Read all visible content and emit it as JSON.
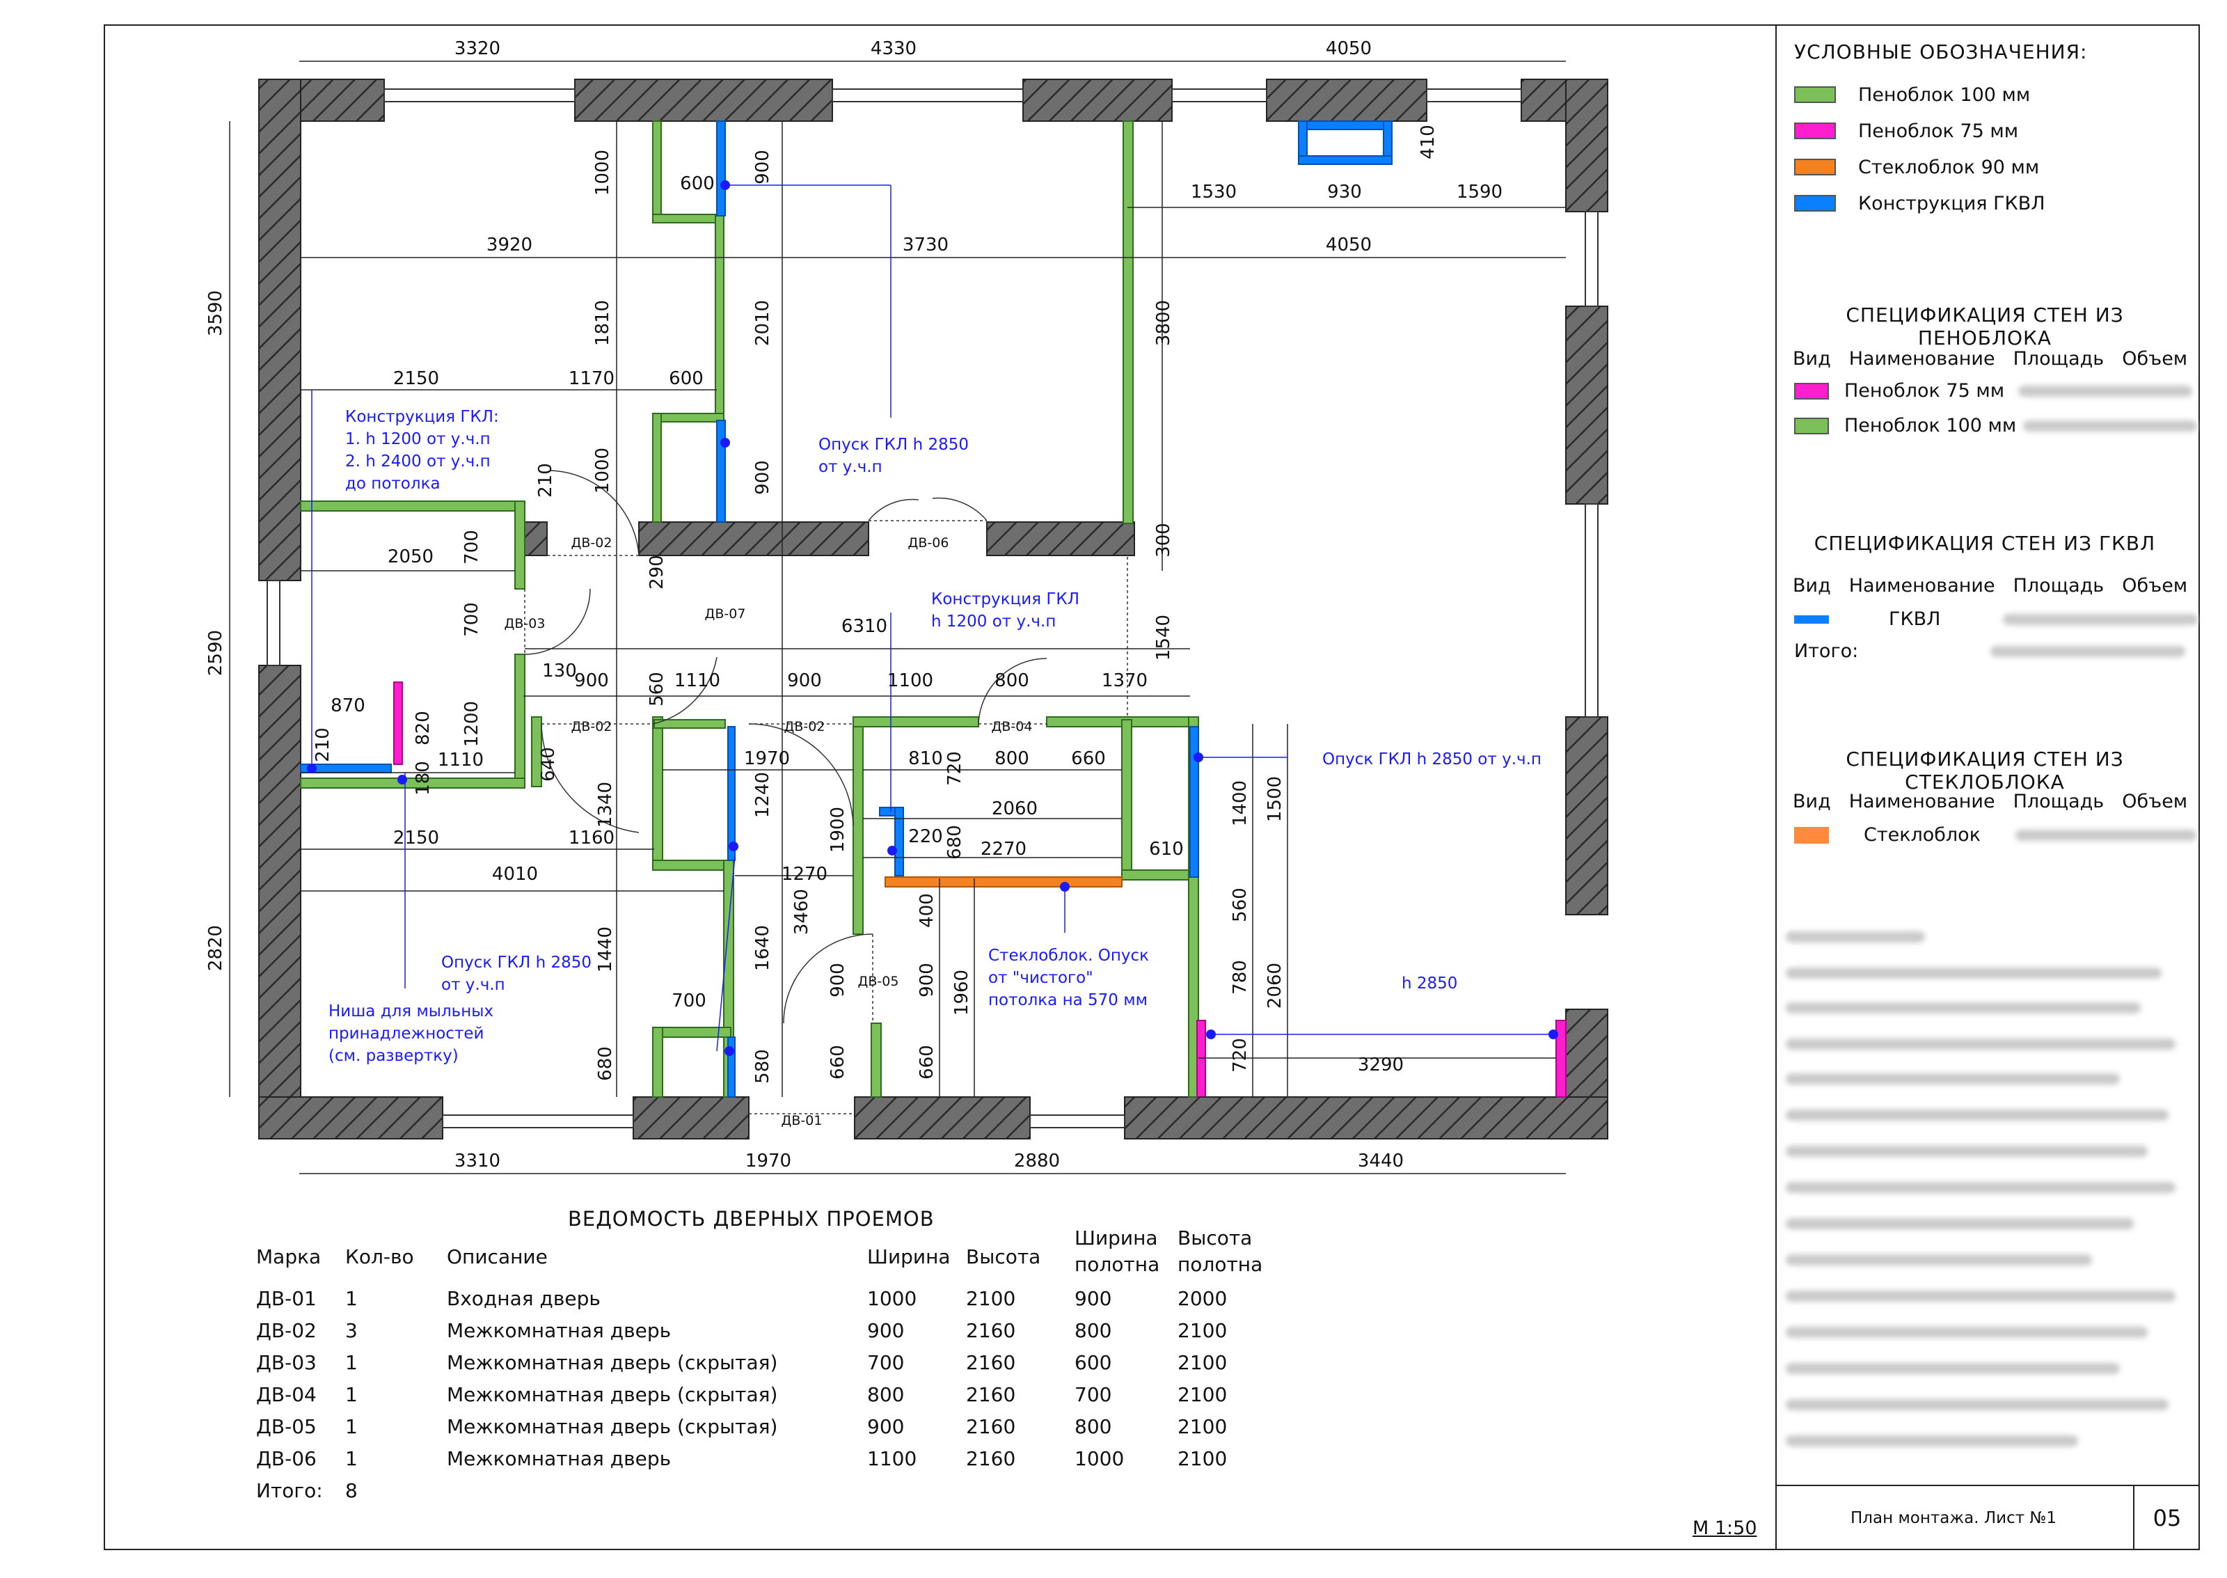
{
  "legend": {
    "title": "УСЛОВНЫЕ ОБОЗНАЧЕНИЯ:",
    "items": [
      {
        "label": "Пеноблок 100 мм",
        "color": "#7cc05a"
      },
      {
        "label": "Пеноблок 75 мм",
        "color": "#ff1ecd"
      },
      {
        "label": "Стеклоблок 90 мм",
        "color": "#f58220"
      },
      {
        "label": "Конструкция ГКВЛ",
        "color": "#0a7fff"
      }
    ]
  },
  "spec_foam": {
    "title": "СПЕЦИФИКАЦИЯ СТЕН ИЗ ПЕНОБЛОКА",
    "headers": [
      "Вид",
      "Наименование",
      "Площадь",
      "Объем"
    ],
    "rows": [
      {
        "name": "Пеноблок 75 мм",
        "color": "#ff1ecd"
      },
      {
        "name": "Пеноблок 100 мм",
        "color": "#7cc05a"
      }
    ]
  },
  "spec_gkvl": {
    "title": "СПЕЦИФИКАЦИЯ СТЕН ИЗ ГКВЛ",
    "headers": [
      "Вид",
      "Наименование",
      "Площадь",
      "Объем"
    ],
    "rows": [
      {
        "name": "ГКВЛ",
        "color": "#0a7fff"
      }
    ],
    "total_label": "Итого:"
  },
  "spec_glass": {
    "title": "СПЕЦИФИКАЦИЯ СТЕН ИЗ СТЕКЛОБЛОКА",
    "headers": [
      "Вид",
      "Наименование",
      "Площадь",
      "Объем"
    ],
    "rows": [
      {
        "name": "Стеклоблок",
        "color": "#ff8a3d"
      }
    ]
  },
  "doors": {
    "title": "ВЕДОМОСТЬ ДВЕРНЫХ ПРОЕМОВ",
    "headers": [
      "Марка",
      "Кол-во",
      "Описание",
      "Ширина",
      "Высота",
      "Ширина полотна",
      "Высота полотна"
    ],
    "rows": [
      [
        "ДВ-01",
        "1",
        "Входная дверь",
        "1000",
        "2100",
        "900",
        "2000"
      ],
      [
        "ДВ-02",
        "3",
        "Межкомнатная дверь",
        "900",
        "2160",
        "800",
        "2100"
      ],
      [
        "ДВ-03",
        "1",
        "Межкомнатная дверь (скрытая)",
        "700",
        "2160",
        "600",
        "2100"
      ],
      [
        "ДВ-04",
        "1",
        "Межкомнатная дверь (скрытая)",
        "800",
        "2160",
        "700",
        "2100"
      ],
      [
        "ДВ-05",
        "1",
        "Межкомнатная дверь (скрытая)",
        "900",
        "2160",
        "800",
        "2100"
      ],
      [
        "ДВ-06",
        "1",
        "Межкомнатная дверь",
        "1100",
        "2160",
        "1000",
        "2100"
      ]
    ],
    "total_label": "Итого:",
    "total_value": "8"
  },
  "title_block": {
    "scale": "М 1:50",
    "sheet_title": "План монтажа. Лист №1",
    "sheet_number": "05"
  },
  "plan": {
    "dims": {
      "top": [
        "3320",
        "4330",
        "4050"
      ],
      "bottom": [
        "3310",
        "1970",
        "2880",
        "3440"
      ],
      "left": [
        "3590",
        "2590",
        "2820"
      ],
      "inner": [
        "600",
        "900",
        "1000",
        "1530",
        "930",
        "1590",
        "410",
        "3920",
        "3730",
        "4050",
        "1810",
        "2010",
        "3800",
        "2150",
        "1170",
        "600",
        "1000",
        "900",
        "210",
        "2050",
        "700",
        "290",
        "300",
        "700",
        "6310",
        "1540",
        "130",
        "900",
        "1110",
        "900",
        "1100",
        "800",
        "1370",
        "560",
        "870",
        "820",
        "1200",
        "210",
        "1110",
        "180",
        "640",
        "1970",
        "810",
        "720",
        "800",
        "660",
        "1400",
        "1500",
        "1340",
        "2060",
        "1900",
        "220",
        "680",
        "2270",
        "610",
        "2150",
        "1160",
        "1240",
        "4010",
        "1270",
        "3460",
        "400",
        "560",
        "1440",
        "1640",
        "900",
        "900",
        "1960",
        "780",
        "2060",
        "700",
        "720",
        "3290",
        "680",
        "580",
        "660",
        "660"
      ]
    },
    "doors": [
      "ДВ-02",
      "ДВ-06",
      "ДВ-03",
      "ДВ-07",
      "ДВ-02",
      "ДВ-02",
      "ДВ-04",
      "ДВ-05",
      "ДВ-01"
    ],
    "notes": {
      "gkl_construction": [
        "Конструкция ГКЛ:",
        "1. h 1200 от у.ч.п",
        "2. h 2400 от у.ч.п",
        "до потолка"
      ],
      "gkl_lower_2850_a": [
        "Опуск ГКЛ h 2850",
        "от у.ч.п"
      ],
      "gkl_construction_1200": [
        "Конструкция ГКЛ",
        "h 1200 от у.ч.п"
      ],
      "gkl_lower_2850_b": [
        "Опуск ГКЛ h 2850 от у.ч.п"
      ],
      "gkl_lower_2850_c": [
        "Опуск ГКЛ h 2850",
        "от у.ч.п"
      ],
      "niche": [
        "Ниша для мыльных",
        "принадлежностей",
        "(см. развертку)"
      ],
      "glass_block": [
        "Стеклоблок. Опуск",
        "от \"чистого\"",
        "потолка на 570 мм"
      ],
      "h2850": [
        "h 2850"
      ]
    }
  }
}
